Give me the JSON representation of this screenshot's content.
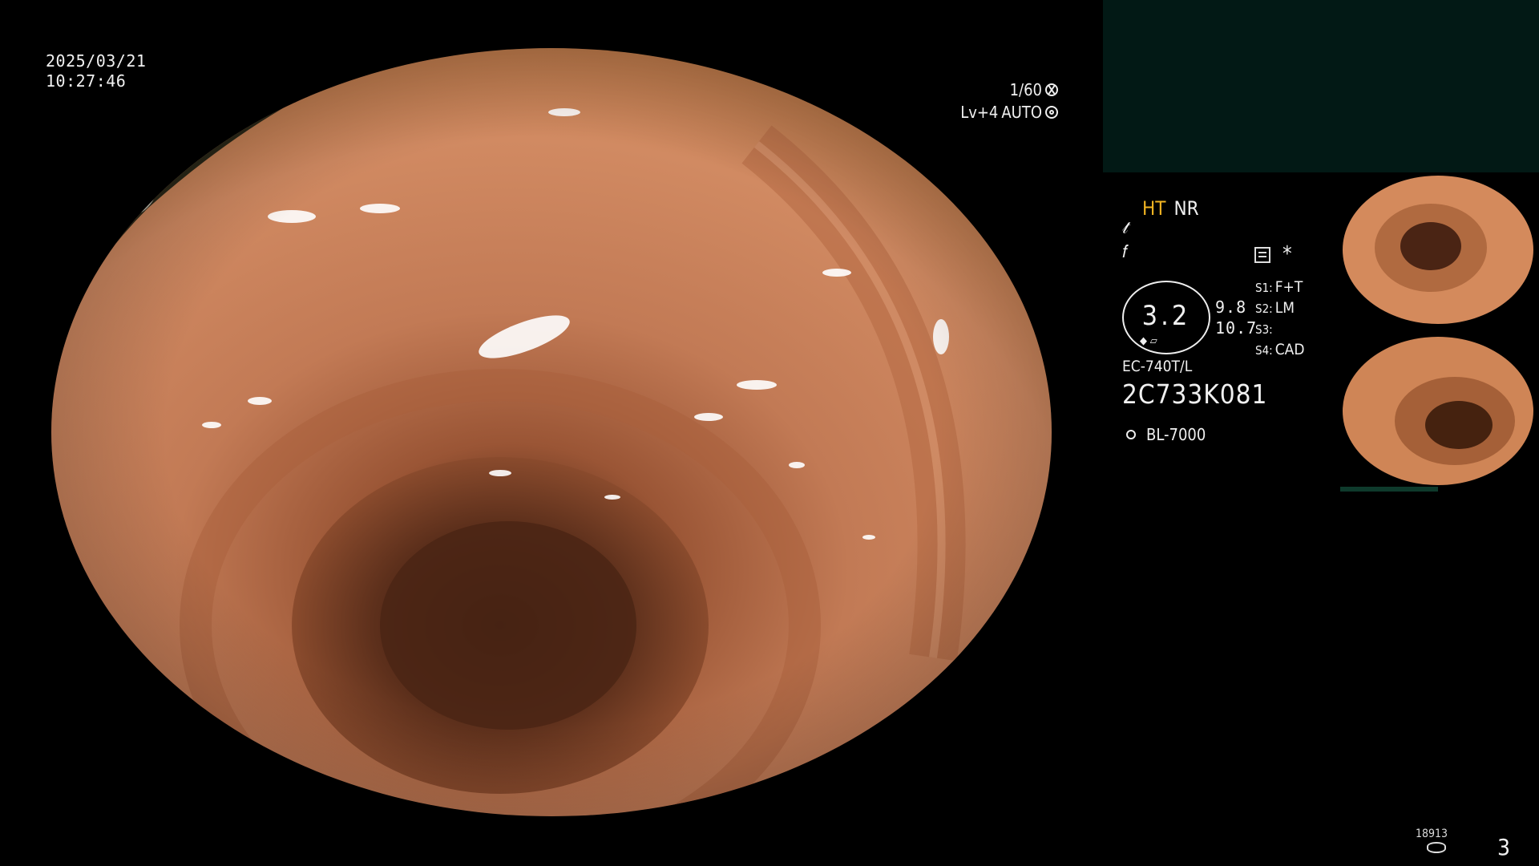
{
  "datetime": {
    "date": "2025/03/21",
    "time": "10:27:46"
  },
  "shutter": {
    "speed": "1/60",
    "level": "Lv+4",
    "mode": "AUTO",
    "speed_icon": "aperture-icon",
    "mode_icon": "gear-icon"
  },
  "panel": {
    "ht": "HT",
    "nr": "NR",
    "symbol1": "𝓉",
    "symbol2": "𝑓",
    "asterisk": "*",
    "gauge_value": "3.2",
    "gauge_value_a": "9.8",
    "gauge_value_b": "10.7",
    "slots": [
      {
        "key": "S1:",
        "value": "F+T"
      },
      {
        "key": "S2:",
        "value": "LM"
      },
      {
        "key": "S3:",
        "value": ""
      },
      {
        "key": "S4:",
        "value": "CAD"
      }
    ],
    "model": "EC-740T/L",
    "serial": "2C733K081",
    "light_source": "BL-7000"
  },
  "footer": {
    "counter": "18913",
    "page": "3"
  },
  "colors": {
    "accent_ht": "#f2b422",
    "top_box": "#021915",
    "tissue": "#c97a55"
  }
}
